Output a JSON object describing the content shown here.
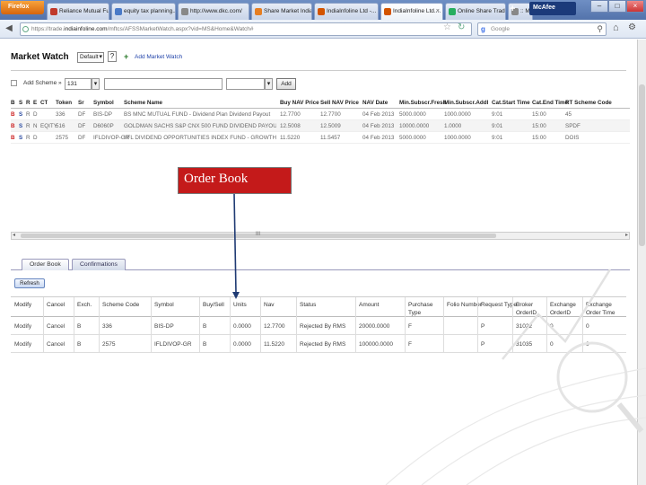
{
  "browser": {
    "firefox_label": "Firefox",
    "tabs": [
      {
        "label": "Reliance Mutual Fund -...",
        "color": "#c0392b"
      },
      {
        "label": "equity tax planning...",
        "color": "#4a7ac7"
      },
      {
        "label": "http://www.dkc.com/",
        "color": "#888888"
      },
      {
        "label": "Share Market India:...",
        "color": "#e67e22"
      },
      {
        "label": "IndiaInfoline Ltd -...",
        "color": "#d35400"
      },
      {
        "label": "IndiaInfoline Ltd....",
        "color": "#d35400"
      },
      {
        "label": "Online Share Tradi...",
        "color": "#27ae60"
      },
      {
        "label": ":: My Account ::",
        "color": "#888888"
      }
    ],
    "tab_close": "×",
    "new_tab": "+",
    "mcafee_label": "McAfee",
    "url_prefix": "https://trade.",
    "url_domain": "indiainfoline.com",
    "url_path": "/mftcs/AFSSMarketWatch.aspx?vid=MS&Home&Watch#",
    "search_placeholder": "Google",
    "window_controls": [
      "–",
      "□",
      "×"
    ]
  },
  "market_watch": {
    "title": "Market Watch",
    "select_value": "Default",
    "help": "?",
    "add_label": "Add Market Watch",
    "add_scheme_label": "Add Scheme »",
    "scheme_code_value": "131",
    "add_button": "Add",
    "columns": [
      "B",
      "S",
      "R",
      "E",
      "CT",
      "Token",
      "Sr",
      "Symbol",
      "Scheme Name",
      "Buy NAV Price",
      "Sell NAV Price",
      "NAV Date",
      "Min.Subscr.Fresh",
      "Min.Subscr.Addl",
      "Cat.Start Time",
      "Cat.End Time",
      "RT Scheme Code"
    ],
    "rows": [
      [
        "B",
        "S",
        "R",
        "D",
        "",
        "336",
        "DF",
        "BIS-DP",
        "BS MNC MUTUAL FUND - Dividend Plan Dividend Payout",
        "12.7700",
        "12.7700",
        "04 Feb 2013",
        "5000.0000",
        "1000.0000",
        "9:01",
        "15:00",
        "45"
      ],
      [
        "B",
        "S",
        "R",
        "N",
        "EQITY",
        "516",
        "DF",
        "D6060P",
        "GOLDMAN SACHS S&P CNX 500 FUND DIVIDEND PAYOUT OPTION",
        "12.5008",
        "12.5009",
        "04 Feb 2013",
        "10000.0000",
        "1.0000",
        "9:01",
        "15:00",
        "SPDF"
      ],
      [
        "B",
        "S",
        "R",
        "D",
        "",
        "2575",
        "DF",
        "IFLDIVOP-GR",
        "IIFL DIVIDEND OPPORTUNITIES INDEX FUND - GROWTH",
        "11.5220",
        "11.5457",
        "04 Feb 2013",
        "5000.0000",
        "1000.0000",
        "9:01",
        "15:00",
        "DOIS"
      ]
    ],
    "scroll_label": "III"
  },
  "order_book": {
    "tabs": [
      "Order Book",
      "Confirmations"
    ],
    "refresh_label": "Refresh",
    "columns": [
      "Modify",
      "Cancel",
      "Exch.",
      "Scheme Code",
      "Symbol",
      "Buy/Sell",
      "Units",
      "Nav",
      "Status",
      "Amount",
      "Purchase Type",
      "Folio Number",
      "Request Type",
      "Broker OrderID",
      "Exchange OrderID",
      "Exchange Order Time"
    ],
    "rows": [
      [
        "Modify",
        "Cancel",
        "B",
        "336",
        "BIS-DP",
        "B",
        "0.0000",
        "12.7700",
        "Rejected By RMS",
        "20000.0000",
        "F",
        "",
        "P",
        "31022",
        "0",
        "0"
      ],
      [
        "Modify",
        "Cancel",
        "B",
        "2575",
        "IFLDIVOP-GR",
        "B",
        "0.0000",
        "11.5220",
        "Rejected By RMS",
        "100000.0000",
        "F",
        "",
        "P",
        "31035",
        "0",
        "0"
      ]
    ]
  },
  "callout": {
    "label": "Order Book"
  }
}
